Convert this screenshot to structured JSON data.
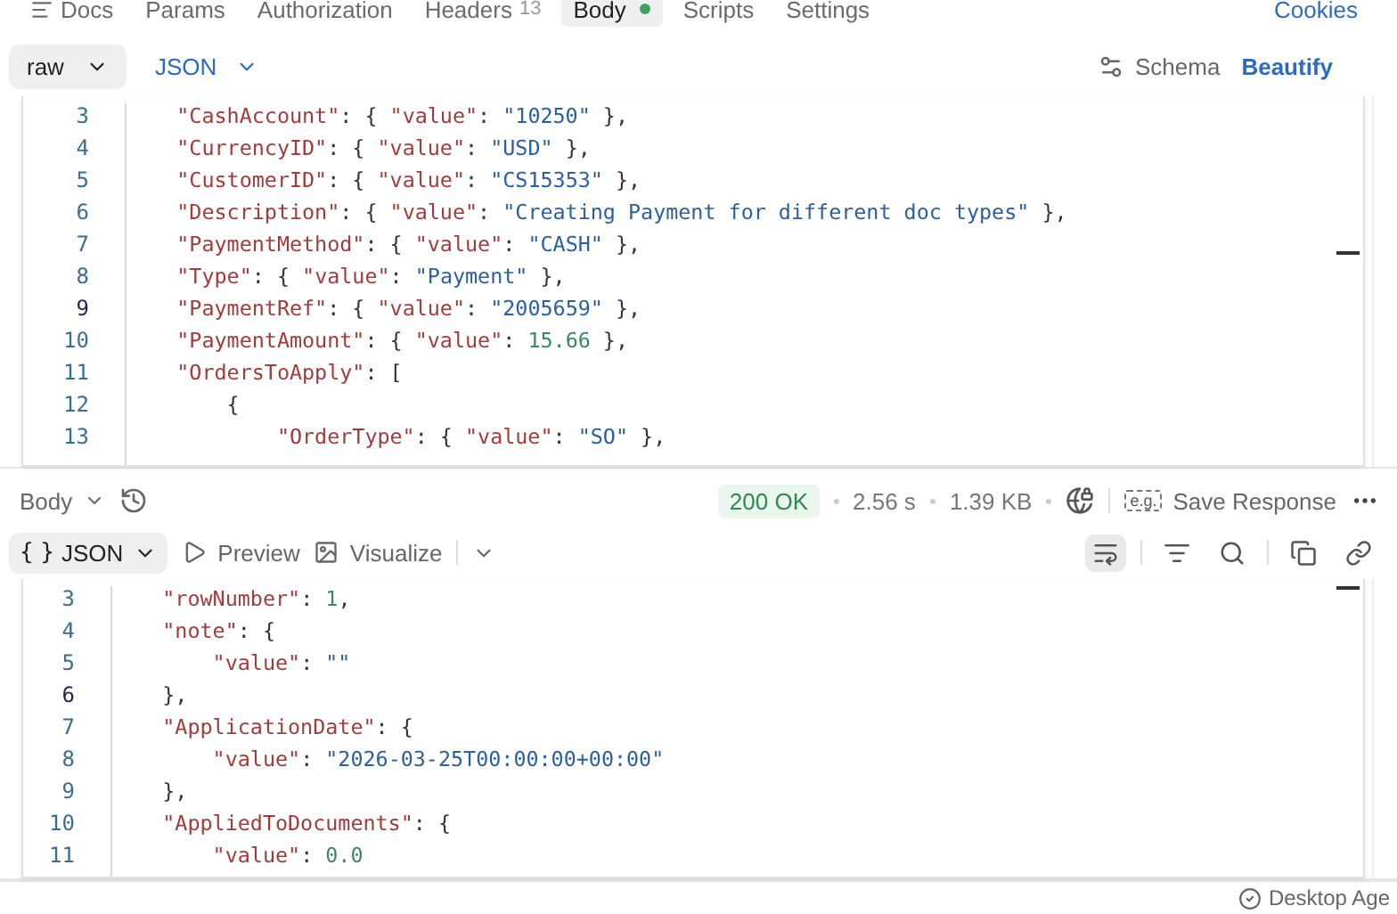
{
  "request_tabs": [
    {
      "kind": "docs",
      "label": "Docs",
      "selected": false
    },
    {
      "kind": "plain",
      "label": "Params",
      "selected": false
    },
    {
      "kind": "plain",
      "label": "Authorization",
      "selected": false
    },
    {
      "kind": "plain",
      "label": "Headers",
      "count": "13",
      "selected": false
    },
    {
      "kind": "dot",
      "label": "Body",
      "selected": true
    },
    {
      "kind": "plain",
      "label": "Scripts",
      "selected": false
    },
    {
      "kind": "plain",
      "label": "Settings",
      "selected": false
    }
  ],
  "cookies_link": "Cookies",
  "body_toolbar": {
    "mode": "raw",
    "language": "JSON",
    "schema": "Schema",
    "beautify": "Beautify"
  },
  "request_editor": {
    "lines": [
      {
        "num": "3",
        "active": false,
        "tokens": [
          {
            "kind": "k",
            "text": "    \"CashAccount\""
          },
          {
            "kind": "p",
            "text": ": { "
          },
          {
            "kind": "k",
            "text": "\"value\""
          },
          {
            "kind": "p",
            "text": ": "
          },
          {
            "kind": "s",
            "text": "\"10250\""
          },
          {
            "kind": "p",
            "text": " },"
          }
        ]
      },
      {
        "num": "4",
        "active": false,
        "tokens": [
          {
            "kind": "k",
            "text": "    \"CurrencyID\""
          },
          {
            "kind": "p",
            "text": ": { "
          },
          {
            "kind": "k",
            "text": "\"value\""
          },
          {
            "kind": "p",
            "text": ": "
          },
          {
            "kind": "s",
            "text": "\"USD\""
          },
          {
            "kind": "p",
            "text": " },"
          }
        ]
      },
      {
        "num": "5",
        "active": false,
        "tokens": [
          {
            "kind": "k",
            "text": "    \"CustomerID\""
          },
          {
            "kind": "p",
            "text": ": { "
          },
          {
            "kind": "k",
            "text": "\"value\""
          },
          {
            "kind": "p",
            "text": ": "
          },
          {
            "kind": "s",
            "text": "\"CS15353\""
          },
          {
            "kind": "p",
            "text": " },"
          }
        ]
      },
      {
        "num": "6",
        "active": false,
        "tokens": [
          {
            "kind": "k",
            "text": "    \"Description\""
          },
          {
            "kind": "p",
            "text": ": { "
          },
          {
            "kind": "k",
            "text": "\"value\""
          },
          {
            "kind": "p",
            "text": ": "
          },
          {
            "kind": "s",
            "text": "\"Creating Payment for different doc types\""
          },
          {
            "kind": "p",
            "text": " },"
          }
        ]
      },
      {
        "num": "7",
        "active": false,
        "tokens": [
          {
            "kind": "k",
            "text": "    \"PaymentMethod\""
          },
          {
            "kind": "p",
            "text": ": { "
          },
          {
            "kind": "k",
            "text": "\"value\""
          },
          {
            "kind": "p",
            "text": ": "
          },
          {
            "kind": "s",
            "text": "\"CASH\""
          },
          {
            "kind": "p",
            "text": " },"
          }
        ]
      },
      {
        "num": "8",
        "active": false,
        "tokens": [
          {
            "kind": "k",
            "text": "    \"Type\""
          },
          {
            "kind": "p",
            "text": ": { "
          },
          {
            "kind": "k",
            "text": "\"value\""
          },
          {
            "kind": "p",
            "text": ": "
          },
          {
            "kind": "s",
            "text": "\"Payment\""
          },
          {
            "kind": "p",
            "text": " },"
          }
        ]
      },
      {
        "num": "9",
        "active": true,
        "tokens": [
          {
            "kind": "k",
            "text": "    \"PaymentRef\""
          },
          {
            "kind": "p",
            "text": ": { "
          },
          {
            "kind": "k",
            "text": "\"value\""
          },
          {
            "kind": "p",
            "text": ": "
          },
          {
            "kind": "s",
            "text": "\"2005659\""
          },
          {
            "kind": "p",
            "text": " },"
          }
        ]
      },
      {
        "num": "10",
        "active": false,
        "tokens": [
          {
            "kind": "k",
            "text": "    \"PaymentAmount\""
          },
          {
            "kind": "p",
            "text": ": { "
          },
          {
            "kind": "k",
            "text": "\"value\""
          },
          {
            "kind": "p",
            "text": ": "
          },
          {
            "kind": "n",
            "text": "15.66"
          },
          {
            "kind": "p",
            "text": " },"
          }
        ]
      },
      {
        "num": "11",
        "active": false,
        "tokens": [
          {
            "kind": "k",
            "text": "    \"OrdersToApply\""
          },
          {
            "kind": "p",
            "text": ": ["
          }
        ]
      },
      {
        "num": "12",
        "active": false,
        "tokens": [
          {
            "kind": "p",
            "text": "        {"
          }
        ]
      },
      {
        "num": "13",
        "active": false,
        "tokens": [
          {
            "kind": "k",
            "text": "            \"OrderType\""
          },
          {
            "kind": "p",
            "text": ": { "
          },
          {
            "kind": "k",
            "text": "\"value\""
          },
          {
            "kind": "p",
            "text": ": "
          },
          {
            "kind": "s",
            "text": "\"SO\""
          },
          {
            "kind": "p",
            "text": " },"
          }
        ]
      }
    ]
  },
  "response_bar": {
    "view": "Body",
    "status": "200 OK",
    "time": "2.56 s",
    "size": "1.39 KB",
    "save_badge": "e.g.",
    "save": "Save Response"
  },
  "response_toolbar": {
    "braces": "{ }",
    "format": "JSON",
    "preview": "Preview",
    "visualize": "Visualize",
    "wrap_on": true
  },
  "response_editor": {
    "lines": [
      {
        "num": "3",
        "active": false,
        "tokens": [
          {
            "kind": "k",
            "text": "    \"rowNumber\""
          },
          {
            "kind": "p",
            "text": ": "
          },
          {
            "kind": "n",
            "text": "1"
          },
          {
            "kind": "p",
            "text": ","
          }
        ]
      },
      {
        "num": "4",
        "active": false,
        "tokens": [
          {
            "kind": "k",
            "text": "    \"note\""
          },
          {
            "kind": "p",
            "text": ": {"
          }
        ]
      },
      {
        "num": "5",
        "active": false,
        "tokens": [
          {
            "kind": "k",
            "text": "        \"value\""
          },
          {
            "kind": "p",
            "text": ": "
          },
          {
            "kind": "s",
            "text": "\"\""
          }
        ]
      },
      {
        "num": "6",
        "active": true,
        "tokens": [
          {
            "kind": "p",
            "text": "    },"
          }
        ]
      },
      {
        "num": "7",
        "active": false,
        "tokens": [
          {
            "kind": "k",
            "text": "    \"ApplicationDate\""
          },
          {
            "kind": "p",
            "text": ": {"
          }
        ]
      },
      {
        "num": "8",
        "active": false,
        "tokens": [
          {
            "kind": "k",
            "text": "        \"value\""
          },
          {
            "kind": "p",
            "text": ": "
          },
          {
            "kind": "s",
            "text": "\"2026-03-25T00:00:00+00:00\""
          }
        ]
      },
      {
        "num": "9",
        "active": false,
        "tokens": [
          {
            "kind": "p",
            "text": "    },"
          }
        ]
      },
      {
        "num": "10",
        "active": false,
        "tokens": [
          {
            "kind": "k",
            "text": "    \"AppliedToDocuments\""
          },
          {
            "kind": "p",
            "text": ": {"
          }
        ]
      },
      {
        "num": "11",
        "active": false,
        "tokens": [
          {
            "kind": "k",
            "text": "        \"value\""
          },
          {
            "kind": "p",
            "text": ": "
          },
          {
            "kind": "n",
            "text": "0.0"
          }
        ]
      }
    ]
  },
  "status_bar": {
    "agent": "Desktop Age"
  }
}
